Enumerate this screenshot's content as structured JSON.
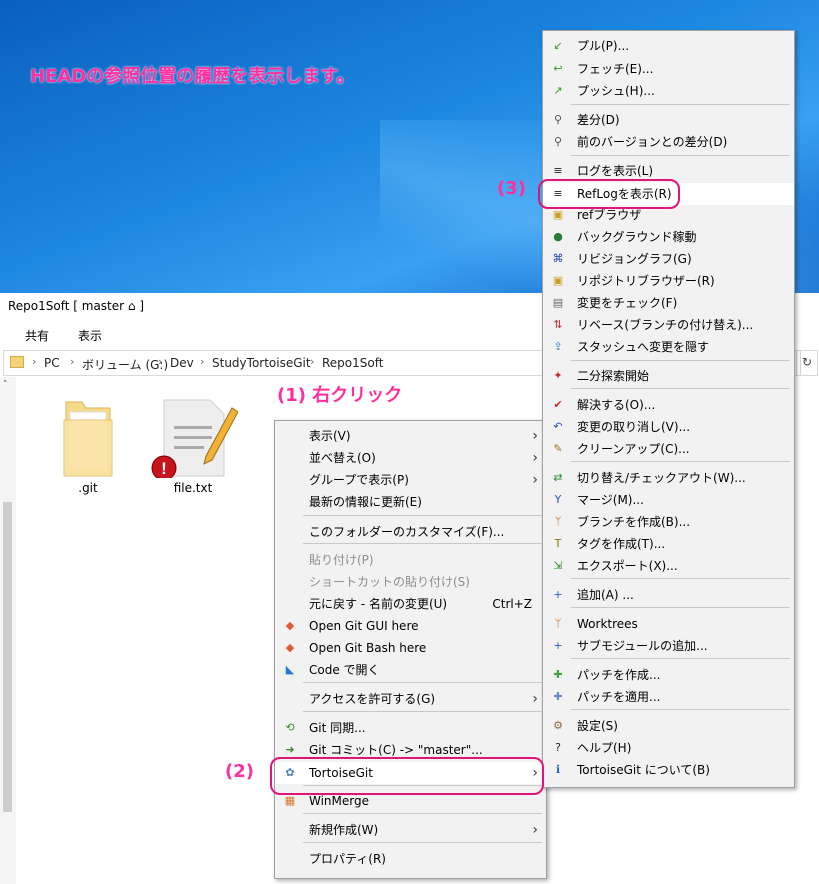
{
  "caption": "HEADの参照位置の履歴を表示します。",
  "window": {
    "title": "Repo1Soft [ master ⌂ ]"
  },
  "ribbon": {
    "share": "共有",
    "view": "表示"
  },
  "address": {
    "parts": [
      "PC",
      "ボリューム (G:)",
      "Dev",
      "StudyTortoiseGit",
      "Repo1Soft"
    ],
    "refresh": "↻"
  },
  "files": [
    {
      "name": ".git"
    },
    {
      "name": "file.txt"
    }
  ],
  "annotations": {
    "step1": "(1) 右クリック",
    "step2": "(2)",
    "step3": "(3)"
  },
  "context_menu": {
    "items": [
      {
        "label": "表示(V)",
        "submenu": true
      },
      {
        "label": "並べ替え(O)",
        "submenu": true
      },
      {
        "label": "グループで表示(P)",
        "submenu": true
      },
      {
        "label": "最新の情報に更新(E)"
      },
      {
        "label": "このフォルダーのカスタマイズ(F)..."
      },
      {
        "label": "貼り付け(P)",
        "disabled": true
      },
      {
        "label": "ショートカットの貼り付け(S)",
        "disabled": true
      },
      {
        "label": "元に戻す - 名前の変更(U)",
        "shortcut": "Ctrl+Z"
      },
      {
        "label": "Open Git GUI here",
        "icon": "git-diamond-icon"
      },
      {
        "label": "Open Git Bash here",
        "icon": "git-diamond-icon"
      },
      {
        "label": "Code で開く",
        "icon": "vscode-icon"
      },
      {
        "label": "アクセスを許可する(G)",
        "submenu": true
      },
      {
        "label": "Git 同期...",
        "icon": "sync-icon"
      },
      {
        "label": "Git コミット(C) -> \"master\"...",
        "icon": "commit-icon"
      },
      {
        "label": "TortoiseGit",
        "submenu": true,
        "icon": "tortoise-icon"
      },
      {
        "label": "WinMerge",
        "icon": "winmerge-icon"
      },
      {
        "label": "新規作成(W)",
        "submenu": true
      },
      {
        "label": "プロパティ(R)"
      }
    ]
  },
  "tortoise_menu": {
    "items": [
      {
        "label": "プル(P)...",
        "icon": "pull-icon"
      },
      {
        "label": "フェッチ(E)...",
        "icon": "fetch-icon"
      },
      {
        "label": "プッシュ(H)...",
        "icon": "push-icon"
      },
      {
        "label": "差分(D)",
        "icon": "diff-icon"
      },
      {
        "label": "前のバージョンとの差分(D)",
        "icon": "diff-prev-icon"
      },
      {
        "label": "ログを表示(L)",
        "icon": "log-icon"
      },
      {
        "label": "RefLogを表示(R)",
        "icon": "reflog-icon"
      },
      {
        "label": "refブラウザ",
        "icon": "ref-browser-icon"
      },
      {
        "label": "バックグラウンド稼動",
        "icon": "globe-icon"
      },
      {
        "label": "リビジョングラフ(G)",
        "icon": "revgraph-icon"
      },
      {
        "label": "リポジトリブラウザー(R)",
        "icon": "repo-browser-icon"
      },
      {
        "label": "変更をチェック(F)",
        "icon": "check-icon"
      },
      {
        "label": "リベース(ブランチの付け替え)...",
        "icon": "rebase-icon"
      },
      {
        "label": "スタッシュへ変更を隠す",
        "icon": "stash-icon"
      },
      {
        "label": "二分探索開始",
        "icon": "bisect-icon"
      },
      {
        "label": "解決する(O)...",
        "icon": "resolve-icon"
      },
      {
        "label": "変更の取り消し(V)...",
        "icon": "revert-icon"
      },
      {
        "label": "クリーンアップ(C)...",
        "icon": "cleanup-icon"
      },
      {
        "label": "切り替え/チェックアウト(W)...",
        "icon": "switch-icon"
      },
      {
        "label": "マージ(M)...",
        "icon": "merge-icon"
      },
      {
        "label": "ブランチを作成(B)...",
        "icon": "branch-icon"
      },
      {
        "label": "タグを作成(T)...",
        "icon": "tag-icon"
      },
      {
        "label": "エクスポート(X)...",
        "icon": "export-icon"
      },
      {
        "label": "追加(A) ...",
        "icon": "add-icon"
      },
      {
        "label": "Worktrees",
        "icon": "worktree-icon"
      },
      {
        "label": "サブモジュールの追加...",
        "icon": "submodule-icon"
      },
      {
        "label": "パッチを作成...",
        "icon": "patch-create-icon"
      },
      {
        "label": "パッチを適用...",
        "icon": "patch-apply-icon"
      },
      {
        "label": "設定(S)",
        "icon": "settings-icon"
      },
      {
        "label": "ヘルプ(H)",
        "icon": "help-icon"
      },
      {
        "label": "TortoiseGit について(B)",
        "icon": "info-icon"
      }
    ]
  }
}
